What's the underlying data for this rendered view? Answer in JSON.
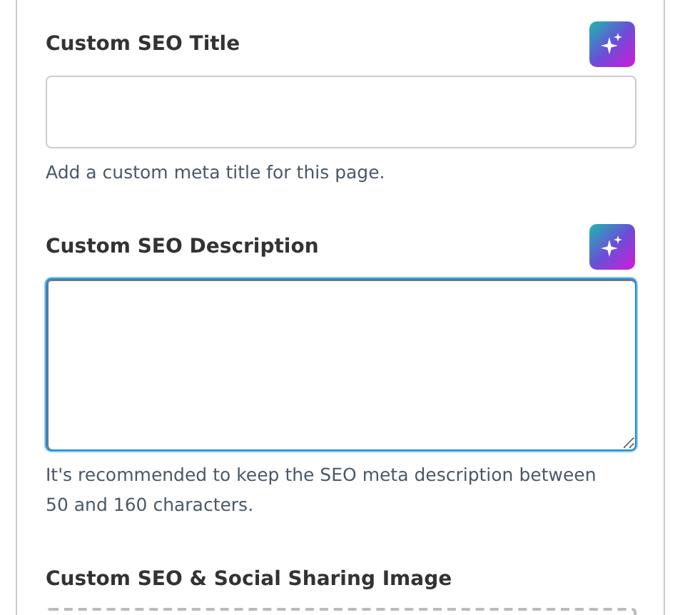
{
  "fields": [
    {
      "kind": "text",
      "label": "Custom SEO Title",
      "ai_button": true,
      "focused": false,
      "help": "Add a custom meta title for this page."
    },
    {
      "kind": "textarea",
      "label": "Custom SEO Description",
      "ai_button": true,
      "focused": true,
      "help": "It's recommended to keep the SEO meta description between 50 and 160 characters."
    },
    {
      "kind": "image",
      "label": "Custom SEO & Social Sharing Image"
    }
  ]
}
